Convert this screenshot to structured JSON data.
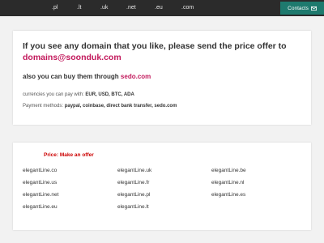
{
  "nav": {
    "tlds": [
      ".pl",
      ".lt",
      ".uk",
      ".net",
      ".eu",
      ".com"
    ],
    "contacts_label": "Contacts"
  },
  "offer": {
    "headline": "If you see any domain that you like, please send the price offer to",
    "email": "domains@soonduk.com",
    "buy_prefix": "also you can buy them through",
    "buy_link": "sedo.com",
    "currencies_label": "currencies you can pay with:",
    "currencies_value": "EUR, USD, BTC, ADA",
    "methods_label": "Payment methods:",
    "methods_value": "paypal, coinbase, direct bank transfer, sedo.com"
  },
  "domains": {
    "price_label": "Price: Make an offer",
    "items": [
      "elegantLine.co",
      "elegantLine.uk",
      "elegantLine.be",
      "elegantLine.us",
      "elegantLine.fr",
      "elegantLine.nl",
      "elegantLine.net",
      "elegantLine.pl",
      "elegantLine.es",
      "elegantLine.eu",
      "elegantLine.lt"
    ]
  },
  "colors": {
    "accent": "#c2185b",
    "contacts_bg": "#1e7a6e",
    "price": "#cc0000"
  }
}
